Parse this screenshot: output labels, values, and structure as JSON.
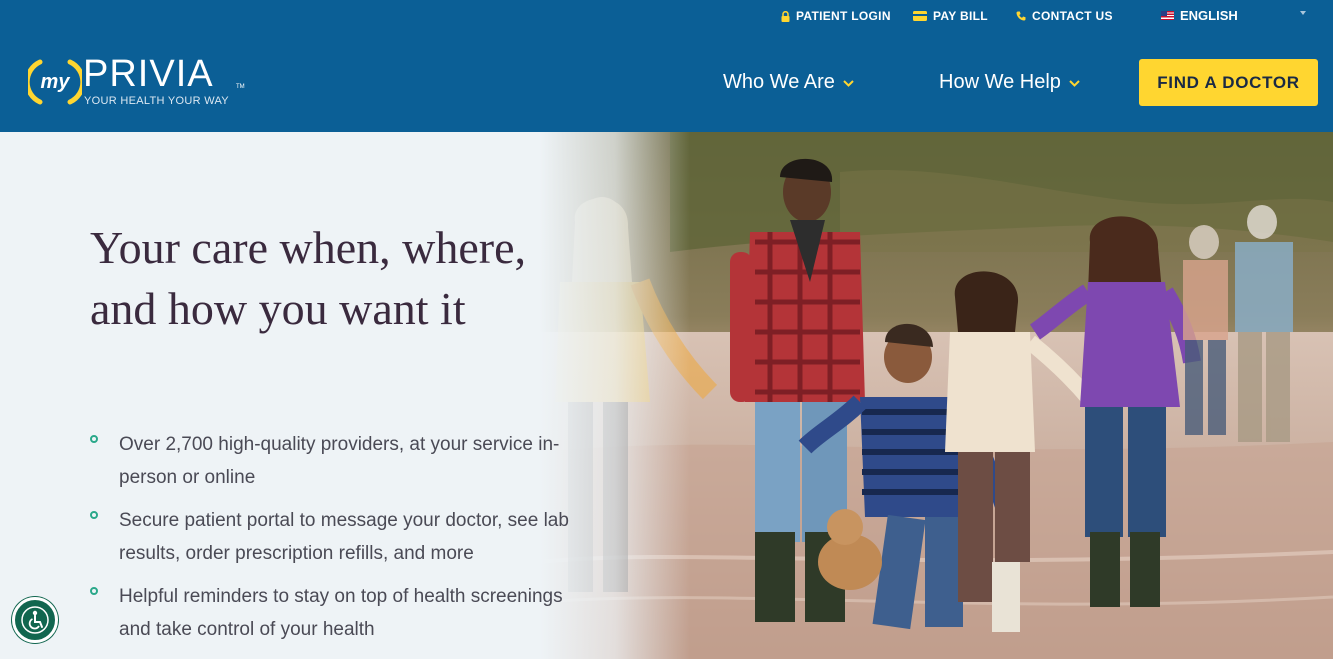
{
  "utility_nav": {
    "patient_login": "PATIENT LOGIN",
    "pay_bill": "PAY BILL",
    "contact_us": "CONTACT US",
    "language": "ENGLISH"
  },
  "logo": {
    "my": "my",
    "brand": "PRIVIA",
    "tm": "TM",
    "tagline": "YOUR HEALTH YOUR WAY"
  },
  "main_nav": {
    "who_we_are": "Who We Are",
    "how_we_help": "How We Help",
    "find_a_doctor": "FIND A DOCTOR"
  },
  "hero": {
    "headline": "Your care when, where, and how you want it",
    "bullets": [
      "Over 2,700 high-quality providers, at your service in-person or online",
      "Secure patient portal to message your doctor, see lab results, order prescription refills, and more",
      "Helpful reminders to stay on top of health screenings and take control of your health"
    ]
  },
  "icons": {
    "patient_login": "lock-icon",
    "pay_bill": "credit-card-icon",
    "contact_us": "phone-icon",
    "language": "us-flag-icon",
    "nav_caret": "chevron-down-icon",
    "accessibility": "accessibility-icon"
  },
  "colors": {
    "header_bg": "#0b5f96",
    "accent_yellow": "#ffd630",
    "bullet_green": "#2aa88a",
    "headline": "#3a2a3e",
    "accessibility_bg": "#11664f"
  }
}
